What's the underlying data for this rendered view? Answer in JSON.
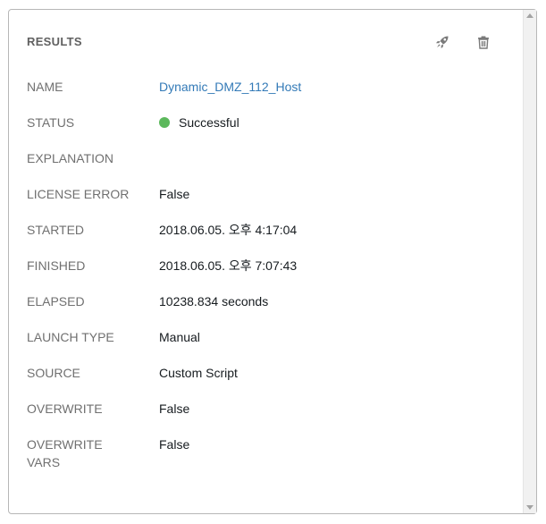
{
  "panel": {
    "title": "RESULTS",
    "icons": {
      "launch": "rocket-icon",
      "delete": "trash-icon"
    }
  },
  "details": {
    "name_label": "NAME",
    "name_value": "Dynamic_DMZ_112_Host",
    "status_label": "STATUS",
    "status_value": "Successful",
    "status_color": "#5cb85c",
    "explanation_label": "EXPLANATION",
    "explanation_value": "",
    "license_error_label": "LICENSE ERROR",
    "license_error_value": "False",
    "started_label": "STARTED",
    "started_value": "2018.06.05. 오후 4:17:04",
    "finished_label": "FINISHED",
    "finished_value": "2018.06.05. 오후 7:07:43",
    "elapsed_label": "ELAPSED",
    "elapsed_value": "10238.834 seconds",
    "launch_type_label": "LAUNCH TYPE",
    "launch_type_value": "Manual",
    "source_label": "SOURCE",
    "source_value": "Custom Script",
    "overwrite_label": "OVERWRITE",
    "overwrite_value": "False",
    "overwrite_vars_label_line1": "OVERWRITE",
    "overwrite_vars_label_line2": "VARS",
    "overwrite_vars_value": "False"
  },
  "colors": {
    "link": "#337ab7",
    "label": "#707070",
    "value": "#161b1f"
  }
}
